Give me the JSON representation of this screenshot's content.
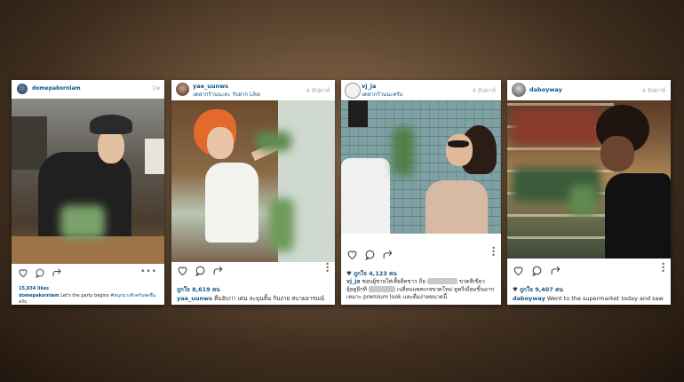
{
  "posts": [
    {
      "username": "domepakornlam",
      "subtitle": "",
      "time": "1w",
      "likes": "15,834 likes",
      "caption_user": "domepakornlam",
      "caption_text": "Let's the party begins",
      "caption_tag": "#สนุกนางฟ้าครับสดชื่น",
      "caption_line2": "ครับ"
    },
    {
      "username": "yae_uunws",
      "subtitle": "งดฝากร้านนะคะ รับฝาก Like",
      "time": "4 สัปดาห์",
      "likes": "ถูกใจ 8,619 คน",
      "caption_user": "yae_uunws",
      "caption_text": "ดื่มอับ!!! เด่น ละมุนลิ้น กินง่าย สบายอารมณ์"
    },
    {
      "username": "vj_ja",
      "subtitle": "งดฝากร้านนะครับ",
      "time": "4 สัปดาห์",
      "likes": "ถูกใจ 4,123 คน",
      "caption_user": "vj_ja",
      "caption_line1a": "ชอบผู้ชายใส่เสื้อยืดขาว ถือ",
      "caption_line1b": "ขวดสีเขียว",
      "caption_line2a": "อุ้ยดูอีกที",
      "caption_line2b": "เปลี่ยนแพคเกจขวดใหม่ ดูพรีเมี่ยมขึ้นมาก",
      "caption_line3": "เหมาะ premium look และดื่มง่ายขนาดนี้"
    },
    {
      "username": "daboyway",
      "subtitle": "",
      "time": "4 สัปดาห์",
      "likes": "ถูกใจ 9,407 คน",
      "caption_user": "daboyway",
      "caption_text": "Went to the supermarket today and saw"
    }
  ],
  "icons": [
    "heart-icon",
    "comment-icon",
    "share-icon",
    "more-icon"
  ],
  "colors": {
    "username": "#125688",
    "time": "#a5a7aa",
    "background": "#3f2e1f"
  }
}
